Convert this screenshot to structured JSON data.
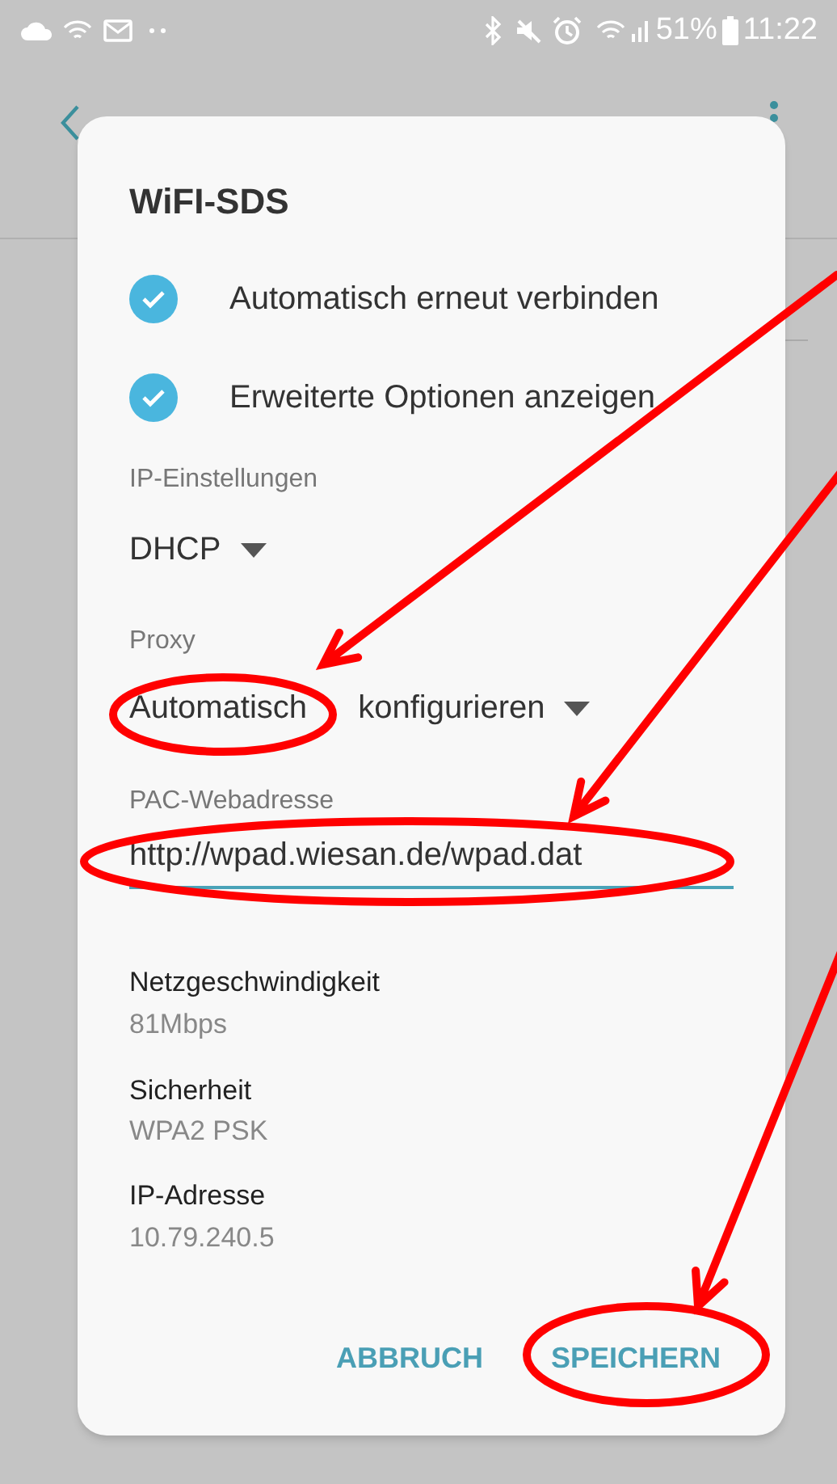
{
  "status_bar": {
    "battery": "51%",
    "time": "11:22"
  },
  "dialog": {
    "title": "WiFI-SDS",
    "options": [
      {
        "label": "Automatisch erneut verbinden",
        "checked": true
      },
      {
        "label": "Erweiterte Optionen anzeigen",
        "checked": true
      }
    ],
    "ip_settings": {
      "label": "IP-Einstellungen",
      "value": "DHCP"
    },
    "proxy": {
      "label": "Proxy",
      "value": "Automatisch konfigurieren"
    },
    "pac": {
      "label": "PAC-Webadresse",
      "value": "http://wpad.wiesan.de/wpad.dat"
    },
    "details": [
      {
        "label": "Netzgeschwindigkeit",
        "value": "81Mbps"
      },
      {
        "label": "Sicherheit",
        "value": "WPA2 PSK"
      },
      {
        "label": "IP-Adresse",
        "value": "10.79.240.5"
      }
    ],
    "buttons": [
      "ABBRUCH",
      "SPEICHERN"
    ]
  },
  "annotations": [
    {
      "kind": "ellipse-arrow"
    },
    {
      "kind": "ellipse-arrow"
    },
    {
      "kind": "ellipse-arrow"
    }
  ]
}
